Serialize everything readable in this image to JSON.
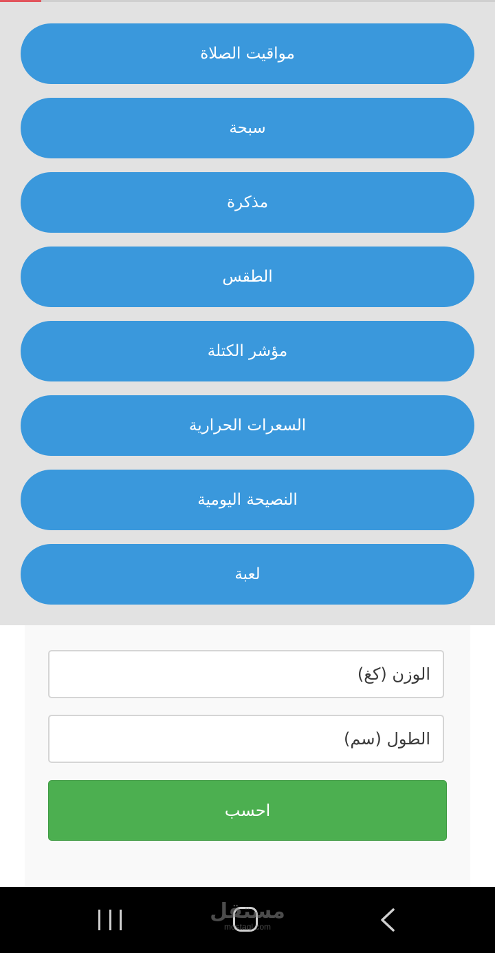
{
  "menu": {
    "items": [
      {
        "label": "مواقيت الصلاة"
      },
      {
        "label": "سبحة"
      },
      {
        "label": "مذكرة"
      },
      {
        "label": "الطقس"
      },
      {
        "label": "مؤشر الكتلة"
      },
      {
        "label": "السعرات الحرارية"
      },
      {
        "label": "النصيحة اليومية"
      },
      {
        "label": "لعبة"
      }
    ]
  },
  "bmi_form": {
    "weight_placeholder": "الوزن (كغ)",
    "height_placeholder": "الطول (سم)",
    "calculate_label": "احسب"
  },
  "watermark": {
    "arabic": "مستقل",
    "latin": "mostaql.com"
  },
  "colors": {
    "menu_button": "#3a98dc",
    "calculate_button": "#4caf50",
    "menu_background": "#e2e2e2",
    "nav_bar": "#000000"
  },
  "icons": {
    "recents": "recent-apps-icon",
    "home": "home-icon",
    "back": "back-arrow-icon"
  }
}
